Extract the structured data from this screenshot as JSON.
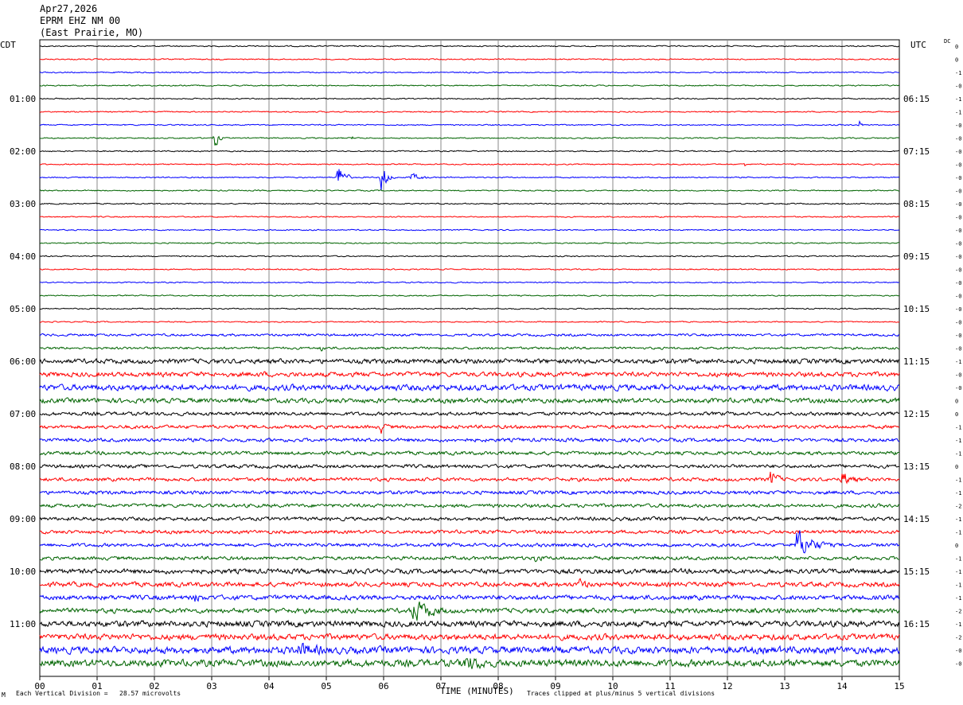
{
  "header": {
    "date": "Apr27,2026",
    "station": "EPRM EHZ NM 00",
    "location": "(East Prairie, MO)"
  },
  "labels": {
    "left_tz": "CDT",
    "right_tz": "UTC",
    "dc": "DC",
    "mark": "M"
  },
  "footer": {
    "vertical_division": "Each Vertical Division =   28.57 microvolts",
    "xlabel": "TIME (MINUTES)",
    "clip_note": "Traces clipped at plus/minus 5 vertical divisions"
  },
  "colors": {
    "trace_cycle": [
      "#000000",
      "#ff0000",
      "#0000ff",
      "#006400"
    ],
    "grid": "#888888"
  },
  "chart_data": {
    "type": "helicorder",
    "x_range_minutes": [
      0,
      15
    ],
    "x_ticks": [
      "00",
      "01",
      "02",
      "03",
      "04",
      "05",
      "06",
      "07",
      "08",
      "09",
      "10",
      "11",
      "12",
      "13",
      "14",
      "15"
    ],
    "row_count": 48,
    "rows_per_hour": 4,
    "left_hour_labels": [
      "01:00",
      "02:00",
      "03:00",
      "04:00",
      "05:00",
      "06:00",
      "07:00",
      "08:00",
      "09:00",
      "10:00",
      "11:00"
    ],
    "right_hour_labels": [
      "06:15",
      "07:15",
      "08:15",
      "09:15",
      "10:15",
      "11:15",
      "12:15",
      "13:15",
      "14:15",
      "15:15",
      "16:15"
    ],
    "dc_offsets": [
      "0",
      "0",
      "-1",
      "-0",
      "-1",
      "-1",
      "-0",
      "-0",
      "-0",
      "-0",
      "-0",
      "-0",
      "-0",
      "-0",
      "-0",
      "-0",
      "-0",
      "-0",
      "-0",
      "-0",
      "-0",
      "-0",
      "-0",
      "-0",
      "-1",
      "-0",
      "-0",
      "0",
      "0",
      "-1",
      "-1",
      "-1",
      "0",
      "-1",
      "-1",
      "-2",
      "-1",
      "-1",
      "0",
      "-1",
      "-1",
      "-1",
      "-1",
      "-2",
      "-1",
      "-2",
      "-0",
      "-0",
      "-0",
      "-3",
      "-2",
      "0"
    ],
    "noise_levels": [
      1,
      1,
      1,
      1,
      1,
      1,
      1,
      1,
      1,
      1,
      1,
      1,
      1,
      1,
      1,
      1,
      1,
      1,
      1,
      1,
      1,
      1,
      2,
      2,
      4,
      4,
      5,
      4,
      3,
      3,
      3,
      3,
      3,
      3,
      3,
      3,
      3,
      3,
      3,
      3,
      4,
      4,
      4,
      4,
      5,
      5,
      6,
      6
    ],
    "events": [
      {
        "row": 7,
        "minute": 3.05,
        "amplitude": 18,
        "duration": 0.2
      },
      {
        "row": 7,
        "minute": 5.45,
        "amplitude": 6,
        "duration": 0.15
      },
      {
        "row": 6,
        "minute": 14.3,
        "amplitude": 10,
        "duration": 0.12
      },
      {
        "row": 10,
        "minute": 5.2,
        "amplitude": 40,
        "duration": 0.25
      },
      {
        "row": 10,
        "minute": 5.95,
        "amplitude": 36,
        "duration": 0.25
      },
      {
        "row": 10,
        "minute": 6.45,
        "amplitude": 8,
        "duration": 0.6
      },
      {
        "row": 9,
        "minute": 12.3,
        "amplitude": 6,
        "duration": 0.08
      },
      {
        "row": 22,
        "minute": 4.5,
        "amplitude": 4,
        "duration": 0.3
      },
      {
        "row": 23,
        "minute": 4.9,
        "amplitude": 6,
        "duration": 0.4
      },
      {
        "row": 25,
        "minute": 3.9,
        "amplitude": 6,
        "duration": 0.3
      },
      {
        "row": 29,
        "minute": 5.95,
        "amplitude": 14,
        "duration": 0.3
      },
      {
        "row": 33,
        "minute": 12.75,
        "amplitude": 18,
        "duration": 0.4
      },
      {
        "row": 33,
        "minute": 14.0,
        "amplitude": 16,
        "duration": 0.6
      },
      {
        "row": 38,
        "minute": 13.2,
        "amplitude": 28,
        "duration": 0.9
      },
      {
        "row": 39,
        "minute": 8.6,
        "amplitude": 10,
        "duration": 0.6
      },
      {
        "row": 41,
        "minute": 9.4,
        "amplitude": 12,
        "duration": 0.6
      },
      {
        "row": 42,
        "minute": 2.7,
        "amplitude": 10,
        "duration": 0.6
      },
      {
        "row": 43,
        "minute": 6.5,
        "amplitude": 22,
        "duration": 1.2
      },
      {
        "row": 46,
        "minute": 4.5,
        "amplitude": 14,
        "duration": 2.0
      },
      {
        "row": 47,
        "minute": 7.4,
        "amplitude": 16,
        "duration": 1.5
      },
      {
        "row": 50,
        "minute": 11.5,
        "amplitude": 12,
        "duration": 1.0
      },
      {
        "row": 51,
        "minute": 12.4,
        "amplitude": 18,
        "duration": 0.3
      }
    ]
  }
}
